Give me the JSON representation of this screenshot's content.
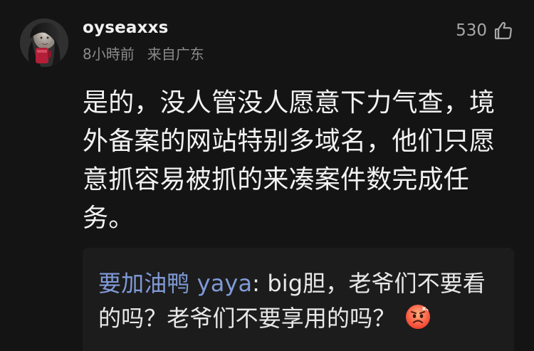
{
  "comment": {
    "username": "oyseaxxs",
    "time": "8小時前",
    "location": "来自广东",
    "likes": "530",
    "body": "是的，没人管没人愿意下力气查，境外备案的网站特别多域名，他们只愿意抓容易被抓的来凑案件数完成任务。"
  },
  "reply": {
    "username": "要加油鸭 yaya",
    "separator": ": ",
    "text": "big胆，老爷们不要看的吗？老爷们不要享用的吗？",
    "emoji": "angry-face"
  },
  "icons": {
    "like": "thumbs-up-icon",
    "avatar": "avatar-image"
  },
  "colors": {
    "background": "#141414",
    "reply_background": "#1c1c1c",
    "reply_username": "#7f9ad6",
    "meta": "#8b8b8b"
  }
}
